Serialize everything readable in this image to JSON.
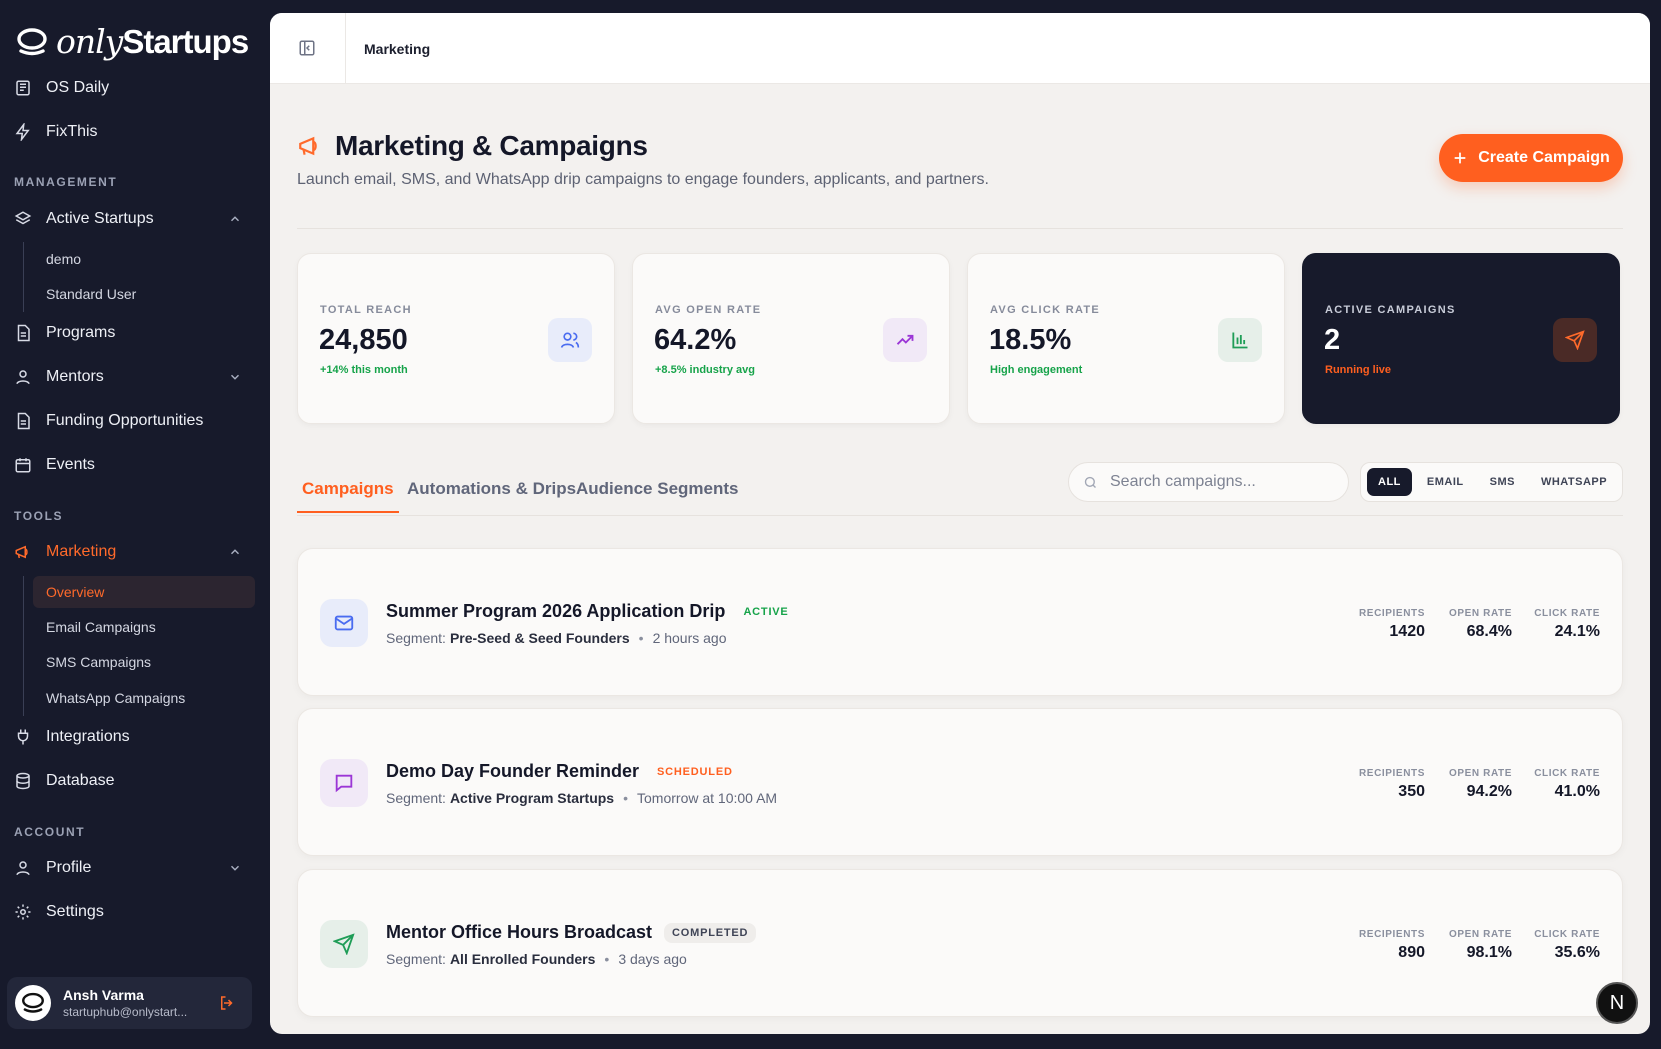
{
  "app": {
    "brand_italic": "only",
    "brand_bold": "Startups"
  },
  "sidebar": {
    "top": [
      {
        "label": "OS Daily",
        "icon": "newspaper-icon"
      },
      {
        "label": "FixThis",
        "icon": "bolt-icon"
      }
    ],
    "management_label": "MANAGEMENT",
    "active_startups": "Active Startups",
    "active_startups_sub": [
      "demo",
      "Standard User"
    ],
    "programs": "Programs",
    "mentors": "Mentors",
    "funding": "Funding Opportunities",
    "events": "Events",
    "tools_label": "TOOLS",
    "marketing": "Marketing",
    "marketing_sub": [
      "Overview",
      "Email Campaigns",
      "SMS Campaigns",
      "WhatsApp Campaigns"
    ],
    "integrations": "Integrations",
    "database": "Database",
    "account_label": "ACCOUNT",
    "profile": "Profile",
    "settings": "Settings",
    "user": {
      "name": "Ansh Varma",
      "email": "startuphub@onlystart..."
    }
  },
  "topbar": {
    "breadcrumb": "Marketing"
  },
  "page": {
    "title": "Marketing & Campaigns",
    "subtitle": "Launch email, SMS, and WhatsApp drip campaigns to engage founders, applicants, and partners.",
    "create_label": "Create Campaign"
  },
  "stats": [
    {
      "label": "TOTAL REACH",
      "value": "24,850",
      "note": "+14% this month",
      "note_color": "#16a34a",
      "icon": "users-icon",
      "icon_bg": "#e8ecfa",
      "icon_color": "#4a6cf0"
    },
    {
      "label": "AVG OPEN RATE",
      "value": "64.2%",
      "note": "+8.5% industry avg",
      "note_color": "#16a34a",
      "icon": "trending-up-icon",
      "icon_bg": "#f1e9f7",
      "icon_color": "#9b36d6"
    },
    {
      "label": "AVG CLICK RATE",
      "value": "18.5%",
      "note": "High engagement",
      "note_color": "#16a34a",
      "icon": "bar-chart-icon",
      "icon_bg": "#e6efe9",
      "icon_color": "#1f9d57"
    },
    {
      "label": "ACTIVE CAMPAIGNS",
      "value": "2",
      "note": "Running live",
      "note_color": "#ff5f1f",
      "icon": "send-icon",
      "icon_bg": "#4a2a26",
      "icon_color": "#ff6a2b"
    }
  ],
  "tabs": [
    "Campaigns",
    "Automations & Drips",
    "Audience Segments"
  ],
  "search": {
    "placeholder": "Search campaigns..."
  },
  "filters": [
    "ALL",
    "EMAIL",
    "SMS",
    "WHATSAPP"
  ],
  "metric_labels": {
    "recipients": "RECIPIENTS",
    "open": "OPEN RATE",
    "click": "CLICK RATE"
  },
  "segment_prefix": "Segment:",
  "campaigns": [
    {
      "title": "Summer Program 2026 Application Drip",
      "status": "ACTIVE",
      "status_color": "#16a34a",
      "segment": "Pre-Seed & Seed Founders",
      "time": "2 hours ago",
      "recipients": "1420",
      "open_rate": "68.4%",
      "click_rate": "24.1%",
      "icon": "mail-icon",
      "icon_bg": "#e8ecfa",
      "icon_color": "#4a6cf0"
    },
    {
      "title": "Demo Day Founder Reminder",
      "status": "SCHEDULED",
      "status_color": "#ff5f1f",
      "segment": "Active Program Startups",
      "time": "Tomorrow at 10:00 AM",
      "recipients": "350",
      "open_rate": "94.2%",
      "click_rate": "41.0%",
      "icon": "message-icon",
      "icon_bg": "#f1e9f7",
      "icon_color": "#9b36d6"
    },
    {
      "title": "Mentor Office Hours Broadcast",
      "status": "COMPLETED",
      "status_color": "#3f4456",
      "segment": "All Enrolled Founders",
      "time": "3 days ago",
      "recipients": "890",
      "open_rate": "98.1%",
      "click_rate": "35.6%",
      "icon": "send-icon",
      "icon_bg": "#e6efe9",
      "icon_color": "#1f9d57"
    }
  ],
  "corner_badge": "N"
}
